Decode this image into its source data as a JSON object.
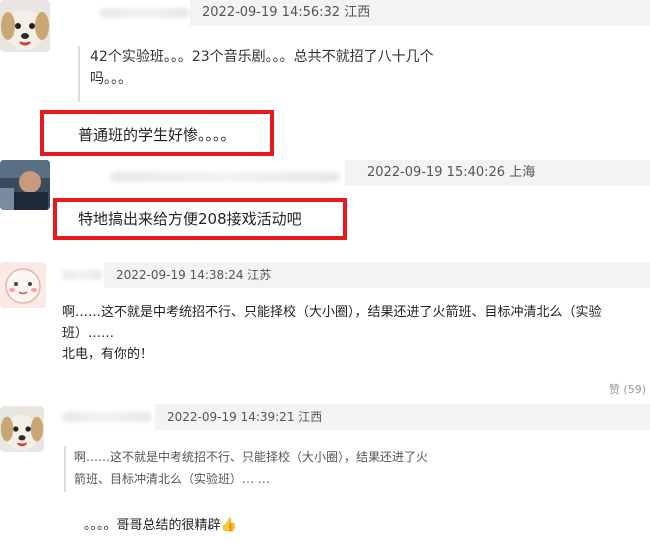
{
  "comments": [
    {
      "meta": "2022-09-19 14:56:32 江西",
      "quote_lines": [
        "42个实验班。。。23个音乐剧。。。总共不就招了八十几个",
        "吗。。。"
      ],
      "reply": "普通班的学生好惨。。。。"
    },
    {
      "meta": "2022-09-19 15:40:26 上海",
      "reply": "特地搞出来给方便208接戏活动吧"
    },
    {
      "meta": "2022-09-19 14:38:24 江苏",
      "body_lines": [
        "啊……这不就是中考统招不行、只能择校（大小圈），结果还进了火箭班、目标冲清北么（实验",
        "班）……",
        "北电，有你的！"
      ],
      "like_label": "赞",
      "like_count": "(59)"
    },
    {
      "meta": "2022-09-19 14:39:21 江西",
      "quote_lines": [
        "啊……这不就是中考统招不行、只能择校（大小圈），结果还进了火",
        "箭班、目标冲清北么（实验班）… …"
      ],
      "reply": "。。。。哥哥总结的很精辟👍"
    }
  ],
  "colors": {
    "highlight_box": "#e8191d",
    "header_bg": "#f2f3f5"
  },
  "icons": [
    "dog-avatar-icon",
    "person-avatar-icon",
    "cartoon-avatar-icon",
    "thumbs-up-icon"
  ]
}
